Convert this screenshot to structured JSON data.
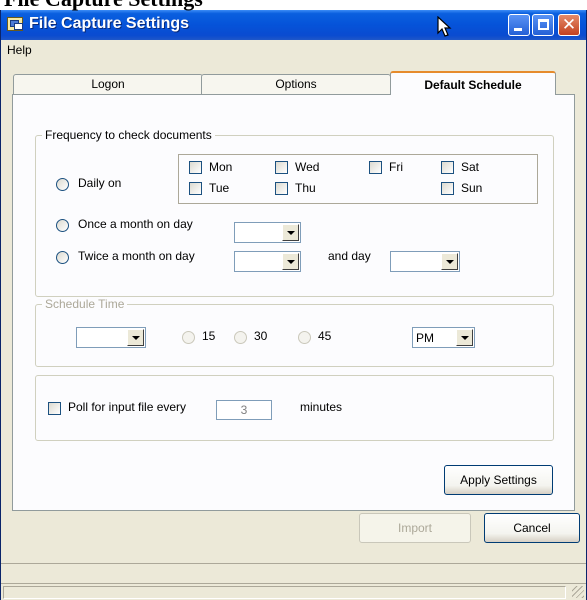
{
  "window": {
    "title": "File Capture Settings"
  },
  "overlay_text": "File Capture Settings",
  "menu": {
    "help": "Help"
  },
  "tabs": [
    {
      "label": "Logon",
      "active": false
    },
    {
      "label": "Options",
      "active": false
    },
    {
      "label": "Default Schedule",
      "active": true
    }
  ],
  "frequency": {
    "legend": "Frequency to check documents",
    "daily_label": "Daily on",
    "days": [
      "Mon",
      "Wed",
      "Fri",
      "Sat",
      "Tue",
      "Thu",
      "Sun"
    ],
    "once_label": "Once a month on day",
    "once_value": "",
    "twice_label": "Twice a month on day",
    "twice_value1": "",
    "and_day_label": "and day",
    "twice_value2": ""
  },
  "schedule_time": {
    "legend": "Schedule Time",
    "hour_value": "",
    "minute_options": [
      "15",
      "30",
      "45"
    ],
    "ampm_value": "PM"
  },
  "poll": {
    "label": "Poll for input file every",
    "value": "3",
    "unit": "minutes"
  },
  "buttons": {
    "apply": "Apply Settings",
    "import": "Import",
    "cancel": "Cancel"
  },
  "colors": {
    "titlebar": "#0553d9",
    "active_tab_accent": "#e68b2c",
    "dialog_bg": "#ece9d8",
    "disabled_text": "#aca899"
  }
}
